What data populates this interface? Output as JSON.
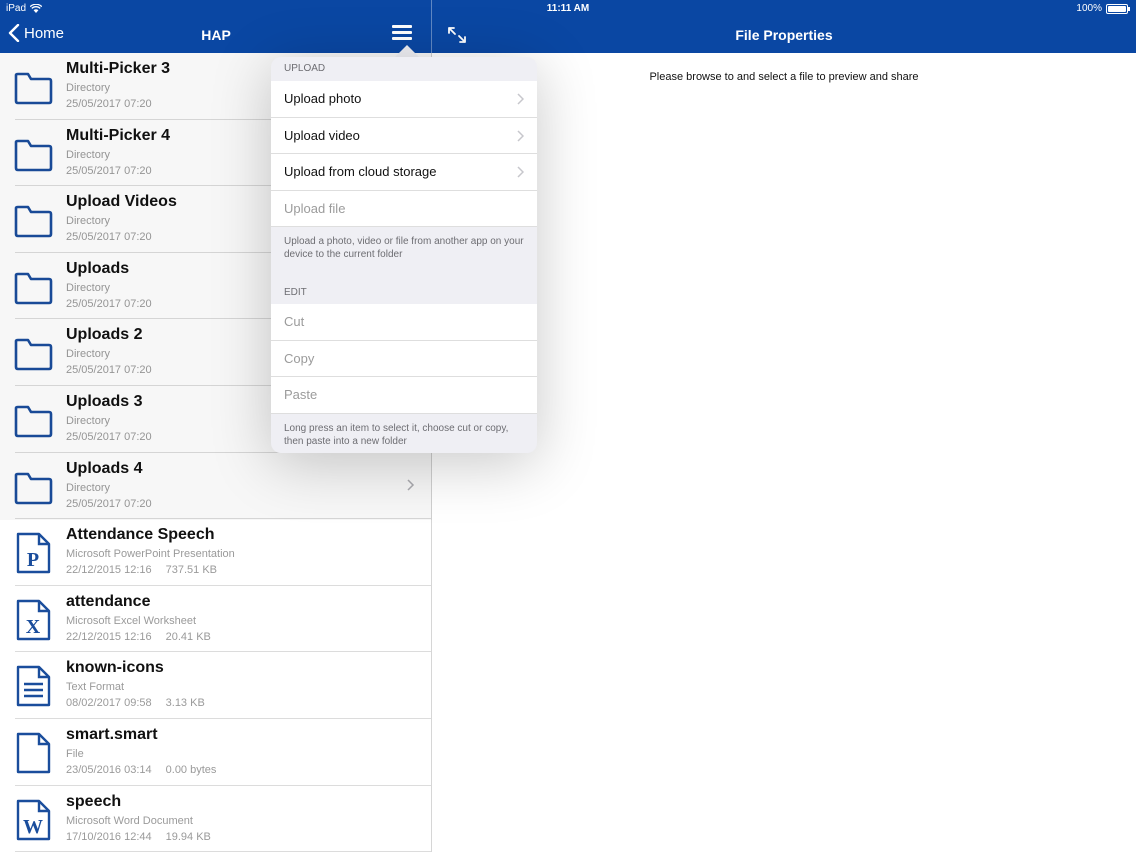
{
  "status": {
    "device": "iPad",
    "time": "11:11 AM",
    "battery": "100%"
  },
  "nav": {
    "back_label": "Home",
    "master_title": "HAP",
    "detail_title": "File Properties"
  },
  "detail": {
    "message": "Please browse to and select a file to preview and share"
  },
  "popover": {
    "upload_header": "UPLOAD",
    "upload_items": [
      "Upload photo",
      "Upload video",
      "Upload from cloud storage",
      "Upload file"
    ],
    "upload_footer": "Upload a photo, video or file from another app on your device to the current folder",
    "edit_header": "EDIT",
    "edit_items": [
      "Cut",
      "Copy",
      "Paste"
    ],
    "edit_footer": "Long press an item to select it, choose cut or copy, then paste into a new folder"
  },
  "files": [
    {
      "name": "Multi-Picker 3",
      "type": "Directory",
      "date": "25/05/2017 07:20",
      "size": "",
      "icon": "folder-icon"
    },
    {
      "name": "Multi-Picker 4",
      "type": "Directory",
      "date": "25/05/2017 07:20",
      "size": "",
      "icon": "folder-icon"
    },
    {
      "name": "Upload Videos",
      "type": "Directory",
      "date": "25/05/2017 07:20",
      "size": "",
      "icon": "folder-icon"
    },
    {
      "name": "Uploads",
      "type": "Directory",
      "date": "25/05/2017 07:20",
      "size": "",
      "icon": "folder-icon"
    },
    {
      "name": "Uploads 2",
      "type": "Directory",
      "date": "25/05/2017 07:20",
      "size": "",
      "icon": "folder-icon"
    },
    {
      "name": "Uploads 3",
      "type": "Directory",
      "date": "25/05/2017 07:20",
      "size": "",
      "icon": "folder-icon"
    },
    {
      "name": "Uploads 4",
      "type": "Directory",
      "date": "25/05/2017 07:20",
      "size": "",
      "icon": "folder-icon"
    },
    {
      "name": "Attendance Speech",
      "type": "Microsoft PowerPoint Presentation",
      "date": "22/12/2015 12:16",
      "size": "737.51 KB",
      "icon": "powerpoint-file-icon"
    },
    {
      "name": "attendance",
      "type": "Microsoft Excel Worksheet",
      "date": "22/12/2015 12:16",
      "size": "20.41 KB",
      "icon": "excel-file-icon"
    },
    {
      "name": "known-icons",
      "type": "Text Format",
      "date": "08/02/2017 09:58",
      "size": "3.13 KB",
      "icon": "text-file-icon"
    },
    {
      "name": "smart.smart",
      "type": "File",
      "date": "23/05/2016 03:14",
      "size": "0.00 bytes",
      "icon": "blank-file-icon"
    },
    {
      "name": "speech",
      "type": "Microsoft Word Document",
      "date": "17/10/2016 12:44",
      "size": "19.94 KB",
      "icon": "word-file-icon"
    }
  ],
  "colors": {
    "nav_bar": "#0a47a3",
    "icon_blue": "#1a4d9c",
    "secondary_text": "#9a9a9a"
  }
}
